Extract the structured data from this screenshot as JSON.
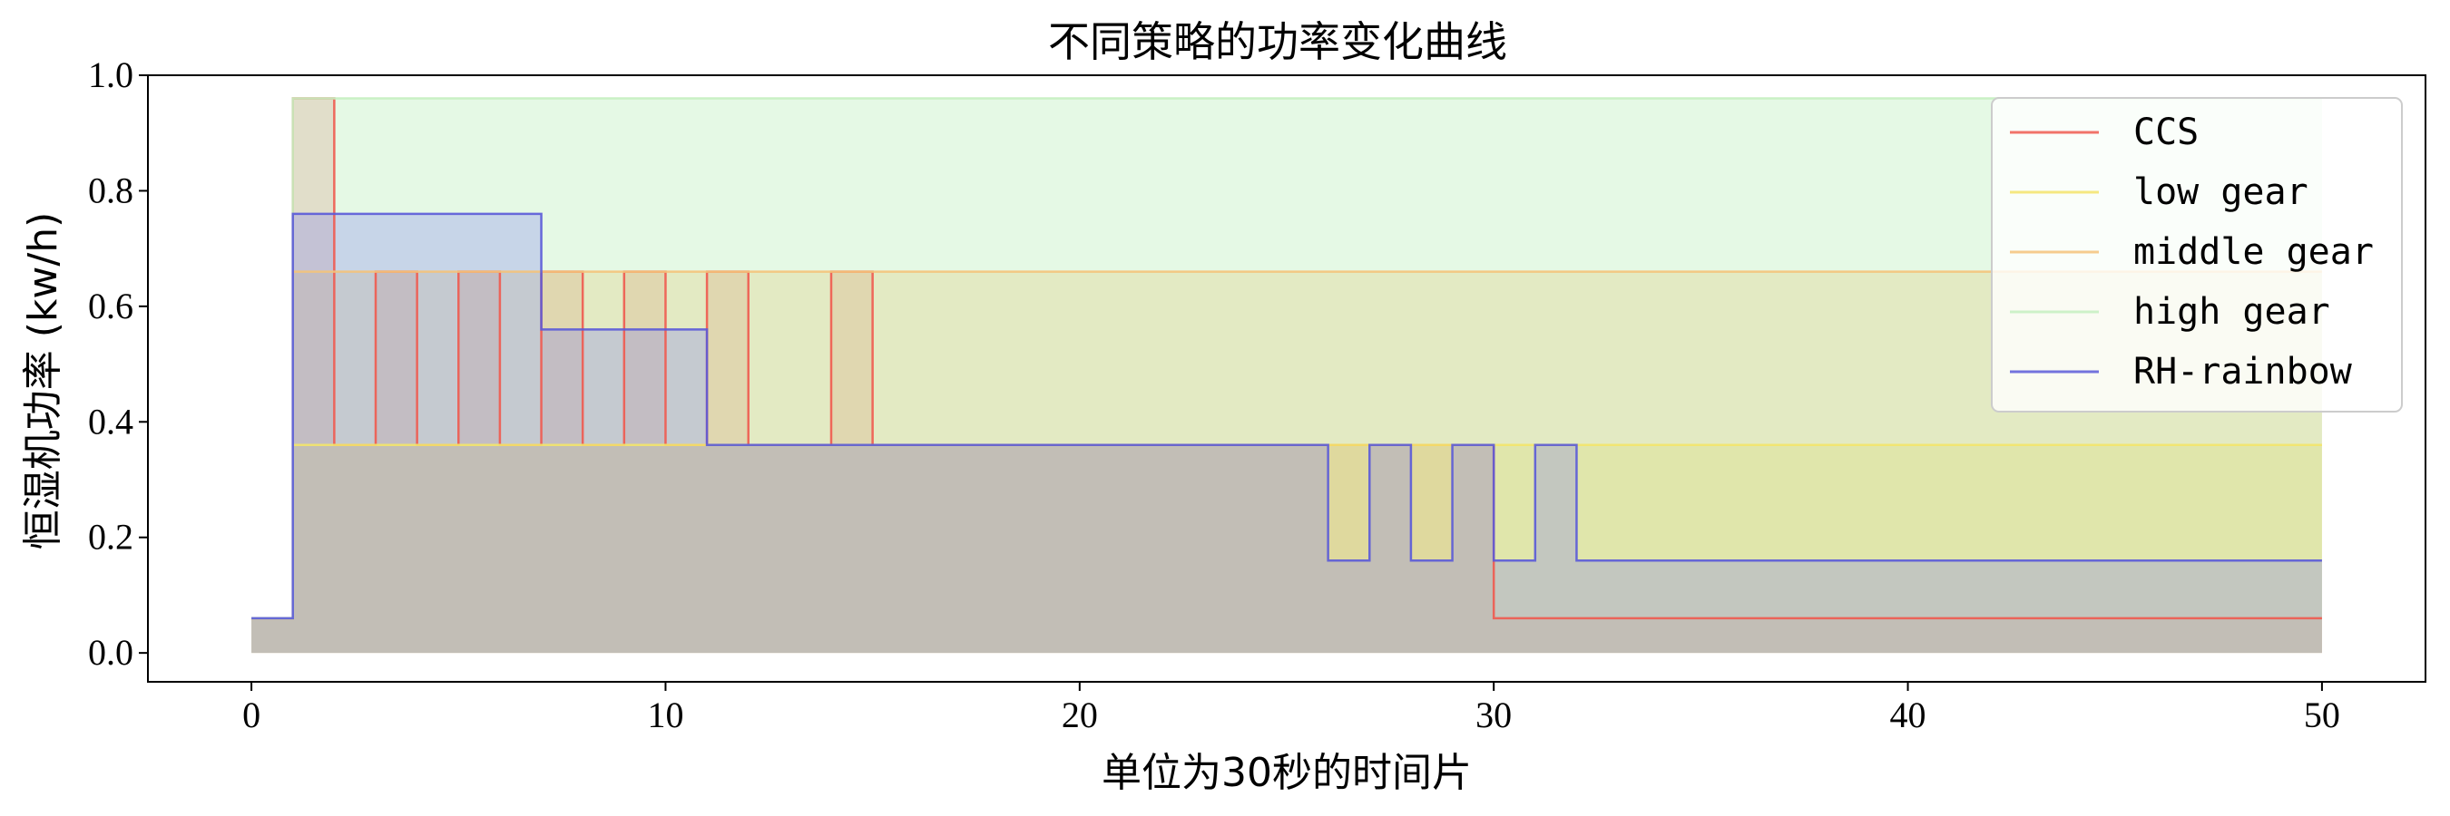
{
  "chart_data": {
    "type": "line",
    "step": "post",
    "title": "不同策略的功率变化曲线",
    "xlabel": "单位为30秒的时间片",
    "ylabel": "恒湿机功率 (kw/h)",
    "xlim": [
      -2.5,
      52.5
    ],
    "ylim": [
      -0.05,
      1.0
    ],
    "xticks": [
      0,
      10,
      20,
      30,
      40,
      50
    ],
    "xtick_labels": [
      "0",
      "10",
      "20",
      "30",
      "40",
      "50"
    ],
    "yticks": [
      0.0,
      0.2,
      0.4,
      0.6,
      0.8,
      1.0
    ],
    "ytick_labels": [
      "0.0",
      "0.2",
      "0.4",
      "0.6",
      "0.8",
      "1.0"
    ],
    "grid": false,
    "fill_to_zero": true,
    "legend_position": "upper-right",
    "x": [
      0,
      1,
      2,
      3,
      4,
      5,
      6,
      7,
      8,
      9,
      10,
      11,
      12,
      13,
      14,
      15,
      16,
      17,
      18,
      19,
      20,
      21,
      22,
      23,
      24,
      25,
      26,
      27,
      28,
      29,
      30,
      31,
      32,
      33,
      34,
      35,
      36,
      37,
      38,
      39,
      40,
      41,
      42,
      43,
      44,
      45,
      46,
      47,
      48,
      49,
      50
    ],
    "series": [
      {
        "name": "CCS",
        "color": "#f08080",
        "line_color": "#ef5a4f",
        "values": [
          0.06,
          0.96,
          0.36,
          0.66,
          0.36,
          0.66,
          0.36,
          0.66,
          0.36,
          0.66,
          0.36,
          0.66,
          0.36,
          0.36,
          0.66,
          0.36,
          0.36,
          0.36,
          0.36,
          0.36,
          0.36,
          0.36,
          0.36,
          0.36,
          0.36,
          0.36,
          0.36,
          0.36,
          0.36,
          0.36,
          0.06,
          0.06,
          0.06,
          0.06,
          0.06,
          0.06,
          0.06,
          0.06,
          0.06,
          0.06,
          0.06,
          0.06,
          0.06,
          0.06,
          0.06,
          0.06,
          0.06,
          0.06,
          0.06,
          0.06,
          0.06
        ]
      },
      {
        "name": "low gear",
        "color": "#f0e060",
        "line_color": "#f3e46a",
        "values": [
          0.06,
          0.36,
          0.36,
          0.36,
          0.36,
          0.36,
          0.36,
          0.36,
          0.36,
          0.36,
          0.36,
          0.36,
          0.36,
          0.36,
          0.36,
          0.36,
          0.36,
          0.36,
          0.36,
          0.36,
          0.36,
          0.36,
          0.36,
          0.36,
          0.36,
          0.36,
          0.36,
          0.36,
          0.36,
          0.36,
          0.36,
          0.36,
          0.36,
          0.36,
          0.36,
          0.36,
          0.36,
          0.36,
          0.36,
          0.36,
          0.36,
          0.36,
          0.36,
          0.36,
          0.36,
          0.36,
          0.36,
          0.36,
          0.36,
          0.36,
          0.36
        ]
      },
      {
        "name": "middle gear",
        "color": "#f5b860",
        "line_color": "#f4c37a",
        "values": [
          0.06,
          0.66,
          0.66,
          0.66,
          0.66,
          0.66,
          0.66,
          0.66,
          0.66,
          0.66,
          0.66,
          0.66,
          0.66,
          0.66,
          0.66,
          0.66,
          0.66,
          0.66,
          0.66,
          0.66,
          0.66,
          0.66,
          0.66,
          0.66,
          0.66,
          0.66,
          0.66,
          0.66,
          0.66,
          0.66,
          0.66,
          0.66,
          0.66,
          0.66,
          0.66,
          0.66,
          0.66,
          0.66,
          0.66,
          0.66,
          0.66,
          0.66,
          0.66,
          0.66,
          0.66,
          0.66,
          0.66,
          0.66,
          0.66,
          0.66,
          0.66
        ]
      },
      {
        "name": "high gear",
        "color": "#a8eaa8",
        "line_color": "#c4efc0",
        "values": [
          0.06,
          0.96,
          0.96,
          0.96,
          0.96,
          0.96,
          0.96,
          0.96,
          0.96,
          0.96,
          0.96,
          0.96,
          0.96,
          0.96,
          0.96,
          0.96,
          0.96,
          0.96,
          0.96,
          0.96,
          0.96,
          0.96,
          0.96,
          0.96,
          0.96,
          0.96,
          0.96,
          0.96,
          0.96,
          0.96,
          0.96,
          0.96,
          0.96,
          0.96,
          0.96,
          0.96,
          0.96,
          0.96,
          0.96,
          0.96,
          0.96,
          0.96,
          0.96,
          0.96,
          0.96,
          0.96,
          0.96,
          0.96,
          0.96,
          0.96,
          0.96
        ]
      },
      {
        "name": "RH-rainbow",
        "color": "#8080f0",
        "line_color": "#5a5ad8",
        "values": [
          0.06,
          0.76,
          0.76,
          0.76,
          0.76,
          0.76,
          0.76,
          0.56,
          0.56,
          0.56,
          0.56,
          0.36,
          0.36,
          0.36,
          0.36,
          0.36,
          0.36,
          0.36,
          0.36,
          0.36,
          0.36,
          0.36,
          0.36,
          0.36,
          0.36,
          0.36,
          0.16,
          0.36,
          0.16,
          0.36,
          0.16,
          0.36,
          0.16,
          0.16,
          0.16,
          0.16,
          0.16,
          0.16,
          0.16,
          0.16,
          0.16,
          0.16,
          0.16,
          0.16,
          0.16,
          0.16,
          0.16,
          0.16,
          0.16,
          0.16,
          0.16
        ]
      }
    ]
  }
}
